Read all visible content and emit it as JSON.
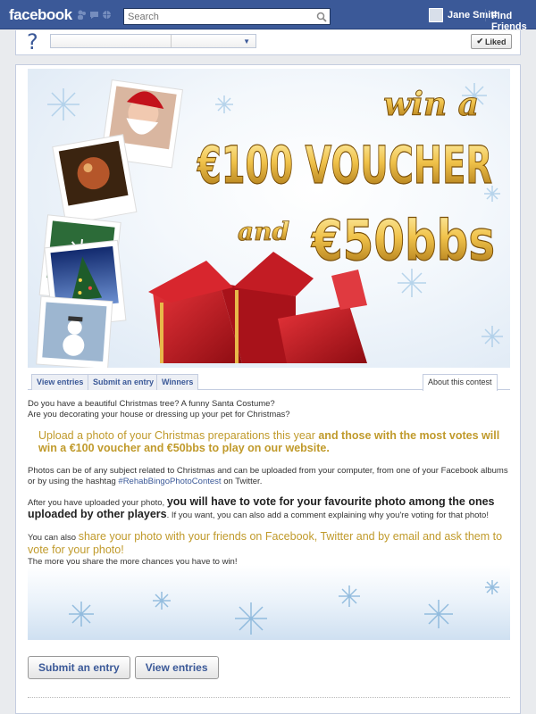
{
  "topbar": {
    "logo": "facebook",
    "search_placeholder": "Search",
    "user_name": "Jane Smith",
    "find_friends": "Find Friends"
  },
  "page_header": {
    "liked_label": "Liked"
  },
  "banner": {
    "line1": "win a",
    "line2": "€100 VOUCHER",
    "line3_and": "and",
    "line3_amount": "€50bbs"
  },
  "tabs": {
    "view_entries": "View entries",
    "submit_entry": "Submit an entry",
    "winners": "Winners",
    "about": "About this contest"
  },
  "content": {
    "p1_line1": "Do you have a beautiful Christmas tree? A funny Santa Costume?",
    "p1_line2": "Are you decorating your house or dressing up your pet for Christmas?",
    "highlight_plain": "Upload a photo of your Christmas preparations this year ",
    "highlight_bold": "and those with the most votes will win a €100 voucher and €50bbs to play on our website.",
    "p2_text": "Photos can be of any subject related to Christmas and can be uploaded from your computer, from one of your Facebook albums or by using the hashtag ",
    "p2_hashtag": "#RehabBingoPhotoContest",
    "p2_end": " on Twitter.",
    "p3_start": "After you have uploaded your photo, ",
    "p3_bold": "you will have to vote for your favourite photo among the ones uploaded by other players",
    "p3_end": ". If you want, you can also add a comment explaining why you're voting for that photo!",
    "p4_start": "You can also ",
    "p4_highlight": "share your photo with your friends on Facebook, Twitter and by email and ask them to vote for your photo!",
    "p4_line2": "The more you share the more chances you have to win!"
  },
  "buttons": {
    "submit": "Submit an entry",
    "view": "View entries"
  },
  "colors": {
    "fb_blue": "#3b5998",
    "gold": "#c09a2b",
    "red_box": "#c8141c"
  }
}
